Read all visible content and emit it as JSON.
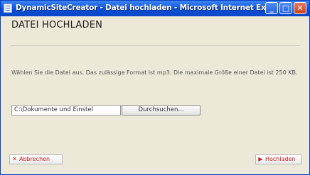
{
  "window": {
    "title": "DynamicSiteCreator - Datei hochladen - Microsoft Internet Ex..."
  },
  "page": {
    "heading": "DATEI HOCHLADEN",
    "description": "Wählen Sie die Datei aus. Das zulässige Format ist mp3. Die maximale Größe einer Datei ist 250 KB.",
    "file_input_value": "C:\\Dokumente und Einstel",
    "browse_label": "Durchsuchen...",
    "cancel_label": "Abbrechen",
    "upload_label": "Hochladen"
  },
  "icons": {
    "minimize": "minimize-icon",
    "maximize": "maximize-icon",
    "close": "close-icon",
    "cancel": "x-icon",
    "upload": "arrow-right-icon"
  },
  "colors": {
    "titlebar": "#0a4fd6",
    "accent_red": "#c41f1f"
  }
}
